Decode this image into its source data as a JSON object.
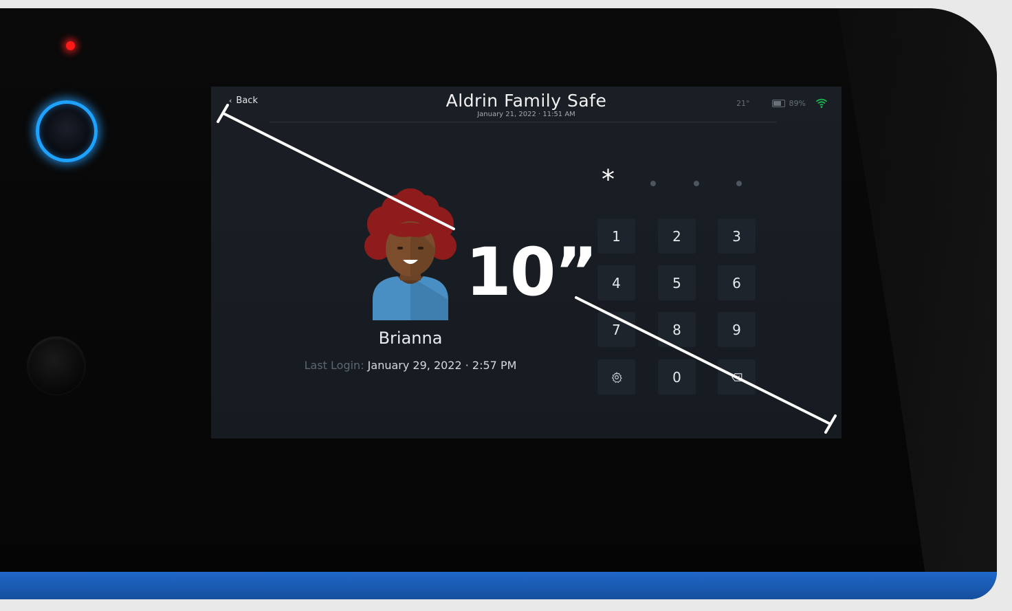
{
  "header": {
    "back_label": "Back",
    "title": "Aldrin Family Safe",
    "datetime": "January 21, 2022 · 11:51 AM"
  },
  "status": {
    "temperature": "21°",
    "battery": "89%",
    "wifi_icon": "wifi-icon",
    "wifi_color": "#1db954"
  },
  "user": {
    "name": "Brianna",
    "last_login_label": "Last Login:",
    "last_login_value": "January 29, 2022 · 2:57 PM"
  },
  "pin": {
    "entered_symbol": "*",
    "remaining_slots": 3
  },
  "keypad": {
    "keys": [
      "1",
      "2",
      "3",
      "4",
      "5",
      "6",
      "7",
      "8",
      "9",
      "settings",
      "0",
      "delete"
    ],
    "k1": "1",
    "k2": "2",
    "k3": "3",
    "k4": "4",
    "k5": "5",
    "k6": "6",
    "k7": "7",
    "k8": "8",
    "k9": "9",
    "k0": "0",
    "settings_icon": "gear-icon",
    "delete_icon": "backspace-icon"
  },
  "annotation": {
    "size_label": "10”"
  },
  "hardware": {
    "led_color": "#ff1a1a",
    "power_ring_color": "#1ea2ff",
    "band_color": "#1f67c9"
  }
}
